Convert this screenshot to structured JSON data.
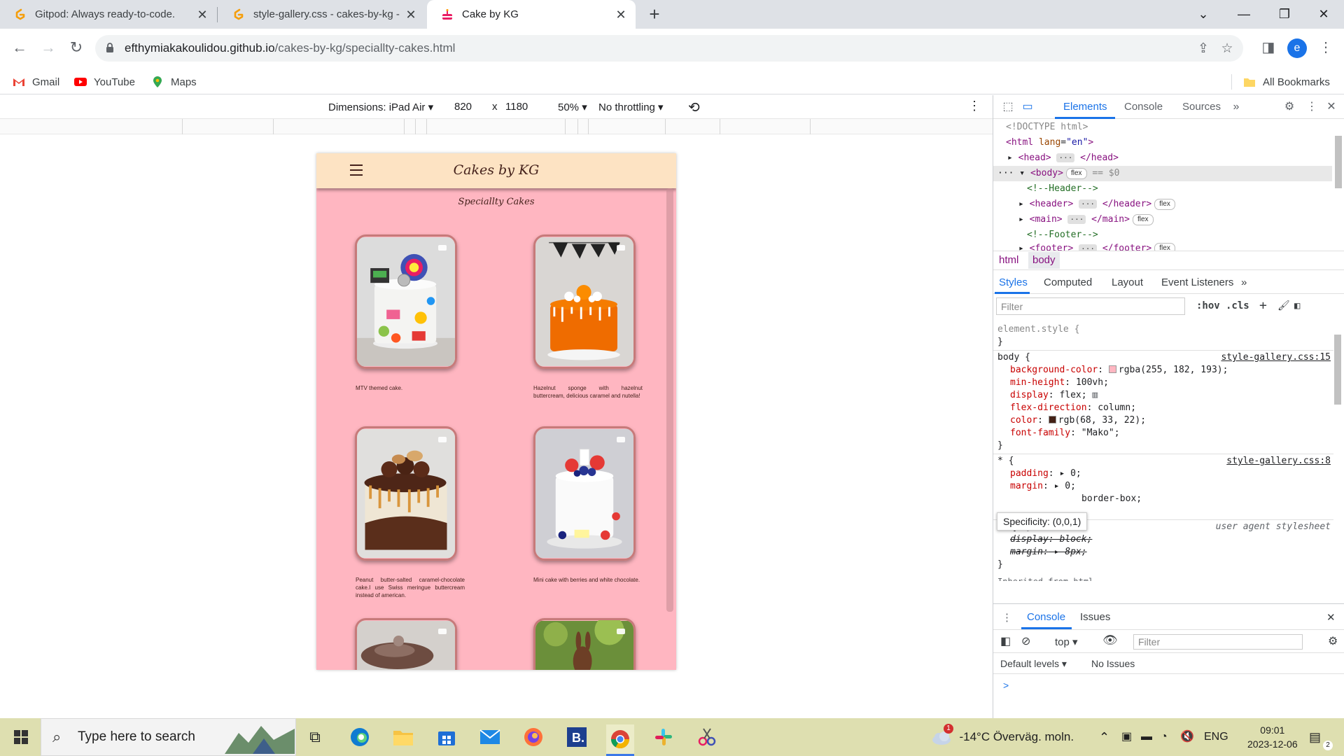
{
  "browser": {
    "tabs": [
      {
        "title": "Gitpod: Always ready-to-code.",
        "active": false
      },
      {
        "title": "style-gallery.css - cakes-by-kg -",
        "active": false
      },
      {
        "title": "Cake by KG",
        "active": true
      }
    ],
    "url_host": "efthymiakakoulidou.github.io",
    "url_path": "/cakes-by-kg/speciallty-cakes.html",
    "profile_initial": "e",
    "bookmarks": [
      "Gmail",
      "YouTube",
      "Maps"
    ],
    "all_bookmarks": "All Bookmarks"
  },
  "device_toolbar": {
    "dimensions": "Dimensions: iPad Air",
    "width": "820",
    "times": "x",
    "height": "1180",
    "zoom": "50%",
    "throttling": "No throttling"
  },
  "site": {
    "title": "Cakes by KG",
    "heading": "Speciallty Cakes",
    "cards": [
      {
        "caption": "MTV themed cake.",
        "image": "mtv-cake"
      },
      {
        "caption": "Hazelnut sponge with hazelnut buttercream, delicious caramel and nutella!",
        "image": "halloween-orange-drip-cake"
      },
      {
        "caption": "Peanut butter-salted caramel-chocolate cake.I use Swiss meringue buttercream instead of american.",
        "image": "chocolate-caramel-drip-cake"
      },
      {
        "caption": "Mini cake with berries and white chocolate.",
        "image": "berries-white-chocolate-cake"
      },
      {
        "caption": "",
        "image": "chocolate-cake-partial"
      },
      {
        "caption": "",
        "image": "bunny-cake-partial"
      }
    ]
  },
  "devtools": {
    "tabs": [
      "Elements",
      "Console",
      "Sources"
    ],
    "dom": {
      "doctype": "<!DOCTYPE html>",
      "html_open": "<html",
      "lang_attr": "lang",
      "lang_val": "\"en\"",
      "head": "<head>",
      "head_close": "</head>",
      "body": "<body>",
      "flex": "flex",
      "eq0": "== $0",
      "comment_header": "<!--Header-->",
      "header": "<header>",
      "header_close": "</header>",
      "main": "<main>",
      "main_close": "</main>",
      "comment_footer": "<!--Footer-->",
      "footer": "<footer>",
      "footer_close": "</footer>",
      "ellipsis": "···"
    },
    "breadcrumbs": [
      "html",
      "body"
    ],
    "subtabs": [
      "Styles",
      "Computed",
      "Layout",
      "Event Listeners"
    ],
    "filter_placeholder": "Filter",
    "hov": ":hov",
    "cls": ".cls",
    "styles": {
      "element_style": "element.style {",
      "close": "}",
      "body_sel": "body {",
      "source1": "style-gallery.css:15",
      "p_bg": "background-color",
      "v_bg": "rgba(255, 182, 193);",
      "p_minh": "min-height",
      "v_minh": "100vh;",
      "p_display": "display",
      "v_display": "flex;",
      "p_flexdir": "flex-direction",
      "v_flexdir": "column;",
      "p_color": "color",
      "v_color": "rgb(68, 33, 22);",
      "p_font": "font-family",
      "v_font": "\"Mako\";",
      "star_sel": "* {",
      "source2": "style-gallery.css:8",
      "p_padding": "padding",
      "v_padding": "0;",
      "p_margin": "margin",
      "v_margin": "0;",
      "v_boxsizing": "border-box;",
      "ua_sel": "body {",
      "ua_source": "user agent stylesheet",
      "ua_display": "display: block;",
      "ua_margin": "margin:",
      "ua_margin_val": "8px;",
      "inherited": "Inherited from html",
      "swatch_bg": "#ffb6c1",
      "swatch_color": "#442116"
    },
    "tooltip": "Specificity: (0,0,1)",
    "drawer": {
      "tabs": [
        "Console",
        "Issues"
      ],
      "context": "top",
      "filter_placeholder": "Filter",
      "levels": "Default levels",
      "issues": "No Issues",
      "prompt": ">"
    }
  },
  "taskbar": {
    "search_placeholder": "Type here to search",
    "weather_badge": "1",
    "weather": "-14°C  Överväg. moln.",
    "lang": "ENG",
    "time": "09:01",
    "date": "2023-12-06",
    "notifications": "2"
  }
}
